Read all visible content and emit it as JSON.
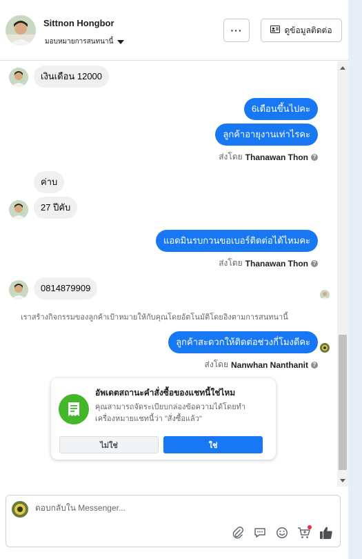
{
  "header": {
    "name": "Sittnon Hongbor",
    "assign_label": "มอบหมายการสนทนานี้",
    "more_label": "···",
    "contact_label": "ดูข้อมูลติดต่อ"
  },
  "messages": {
    "in_1": "เงินเดือน 12000",
    "out_1": "6เดือนขึ้นไปคะ",
    "out_2": "ลูกค้าอายุงานเท่าไรคะ",
    "sent_by_1_prefix": "ส่งโดย",
    "sent_by_1_name": "Thanawan Thon",
    "in_2": "ค่าบ",
    "in_3": "27 ปีคับ",
    "out_3": "แอดมินรบกวนขอเบอร์ติดต่อได้ไหมคะ",
    "sent_by_2_prefix": "ส่งโดย",
    "sent_by_2_name": "Thanawan Thon",
    "in_4": "0814879909",
    "system_note": "เราสร้างกิจกรรมของลูกค้าเป้าหมายให้กับคุณโดยอัตโนมัติโดยอิงตามการสนทนานี้",
    "out_4": "ลูกค้าสะดวกให้ติดต่อช่วงกี่โมงดีคะ",
    "sent_by_3_prefix": "ส่งโดย",
    "sent_by_3_name": "Nanwhan Nanthanit"
  },
  "order_card": {
    "title": "อัพเดตสถานะคำสั่งซื้อของแชทนี้ใช่ไหม",
    "body": "คุณสามารถจัดระเบียบกล่องข้อความได้โดยทำเครื่องหมายแชทนี้ว่า \"สั่งซื้อแล้ว\"",
    "no_label": "ไม่ใช่",
    "yes_label": "ใช่"
  },
  "composer": {
    "placeholder": "ตอบกลับใน Messenger...",
    "icons": [
      "paperclip-icon",
      "saved-reply-icon",
      "emoji-icon",
      "cart-icon",
      "thumbs-up-icon"
    ]
  },
  "colors": {
    "accent": "#1877f2",
    "incoming_bubble": "#f0f0f0",
    "card_icon": "#42b72a",
    "notification": "#f02849"
  }
}
